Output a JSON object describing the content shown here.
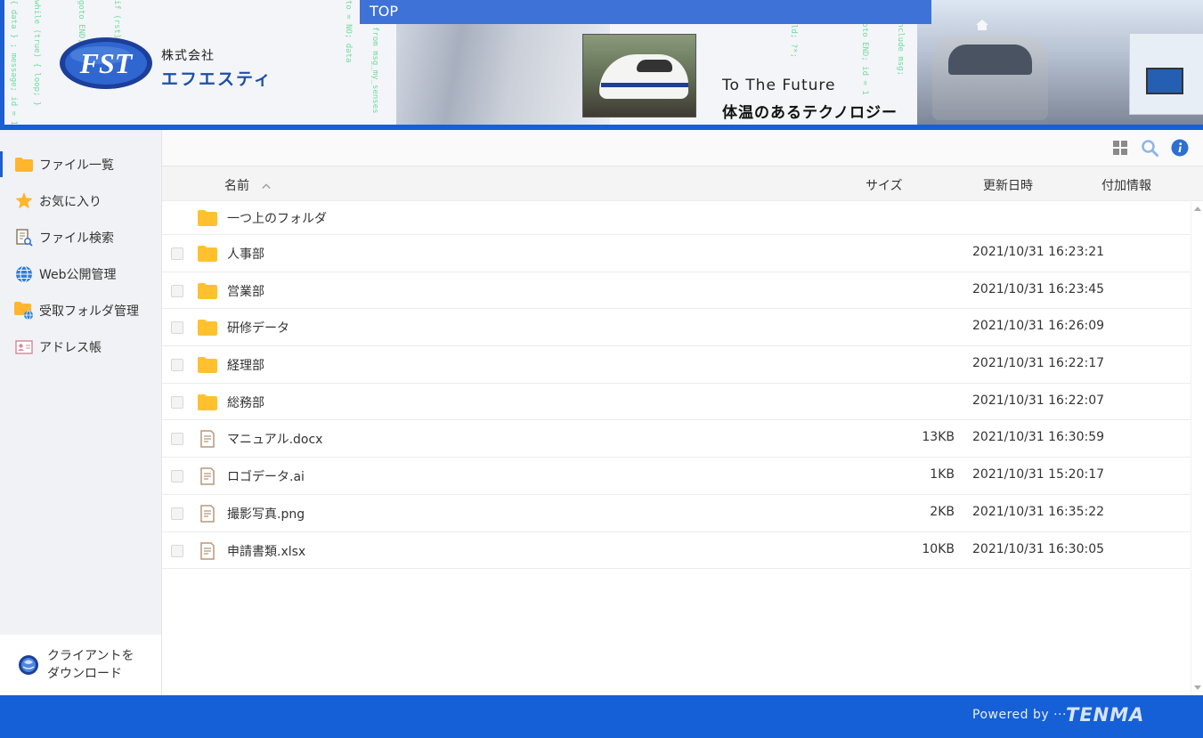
{
  "header": {
    "company_prefix": "株式会社",
    "company_name": "エフエスティ",
    "logo_text": "FST",
    "top_label": "TOP",
    "tagline_en": "To The Future",
    "tagline_jp": "体温のあるテクノロジー"
  },
  "sidebar": {
    "items": [
      {
        "label": "ファイル一覧",
        "icon": "folder-icon",
        "active": true
      },
      {
        "label": "お気に入り",
        "icon": "star-icon",
        "active": false
      },
      {
        "label": "ファイル検索",
        "icon": "file-search-icon",
        "active": false
      },
      {
        "label": "Web公開管理",
        "icon": "globe-icon",
        "active": false
      },
      {
        "label": "受取フォルダ管理",
        "icon": "inbox-folder-icon",
        "active": false
      },
      {
        "label": "アドレス帳",
        "icon": "address-book-icon",
        "active": false
      }
    ],
    "download": {
      "line1": "クライアントを",
      "line2": "ダウンロード"
    }
  },
  "toolbar": {
    "icons": [
      "grid-view-icon",
      "search-icon",
      "info-icon"
    ]
  },
  "table": {
    "columns": {
      "name": "名前",
      "size": "サイズ",
      "updated": "更新日時",
      "extra": "付加情報"
    },
    "parent_folder": "一つ上のフォルダ",
    "rows": [
      {
        "type": "folder",
        "name": "人事部",
        "size": "",
        "updated": "2021/10/31 16:23:21"
      },
      {
        "type": "folder",
        "name": "営業部",
        "size": "",
        "updated": "2021/10/31 16:23:45"
      },
      {
        "type": "folder",
        "name": "研修データ",
        "size": "",
        "updated": "2021/10/31 16:26:09"
      },
      {
        "type": "folder",
        "name": "経理部",
        "size": "",
        "updated": "2021/10/31 16:22:17"
      },
      {
        "type": "folder",
        "name": "総務部",
        "size": "",
        "updated": "2021/10/31 16:22:07"
      },
      {
        "type": "file",
        "name": "マニュアル.docx",
        "size": "13KB",
        "updated": "2021/10/31 16:30:59"
      },
      {
        "type": "file",
        "name": "ロゴデータ.ai",
        "size": "1KB",
        "updated": "2021/10/31 15:20:17"
      },
      {
        "type": "file",
        "name": "撮影写真.png",
        "size": "2KB",
        "updated": "2021/10/31 16:35:22"
      },
      {
        "type": "file",
        "name": "申請書類.xlsx",
        "size": "10KB",
        "updated": "2021/10/31 16:30:05"
      }
    ]
  },
  "footer": {
    "powered_by": "Powered by ···",
    "brand": "TENMA"
  },
  "colors": {
    "accent": "#1560d6",
    "folder": "#ffc12e",
    "sidebar_bg": "#f1f2f6"
  }
}
